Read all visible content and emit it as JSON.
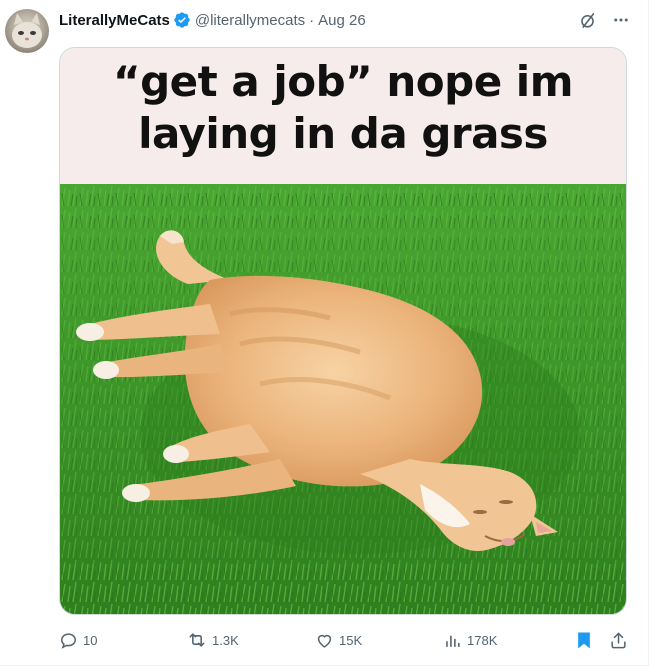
{
  "tweet": {
    "display_name": "LiterallyMeCats",
    "handle": "@literallymecats",
    "separator": "·",
    "date": "Aug 26"
  },
  "media": {
    "caption_line1": "“get a job” nope im",
    "caption_line2": "laying in da grass"
  },
  "actions": {
    "replies": "10",
    "reposts": "1.3K",
    "likes": "15K",
    "views": "178K"
  },
  "colors": {
    "accent": "#1d9bf0",
    "muted": "#536471",
    "text": "#0f1419",
    "caption_bg": "#f7ecec",
    "grass": "#3f9a2a"
  },
  "icons": [
    "grok-icon",
    "more-icon",
    "verified-badge-icon",
    "reply-icon",
    "repost-icon",
    "like-icon",
    "views-icon",
    "bookmark-icon",
    "share-icon"
  ]
}
